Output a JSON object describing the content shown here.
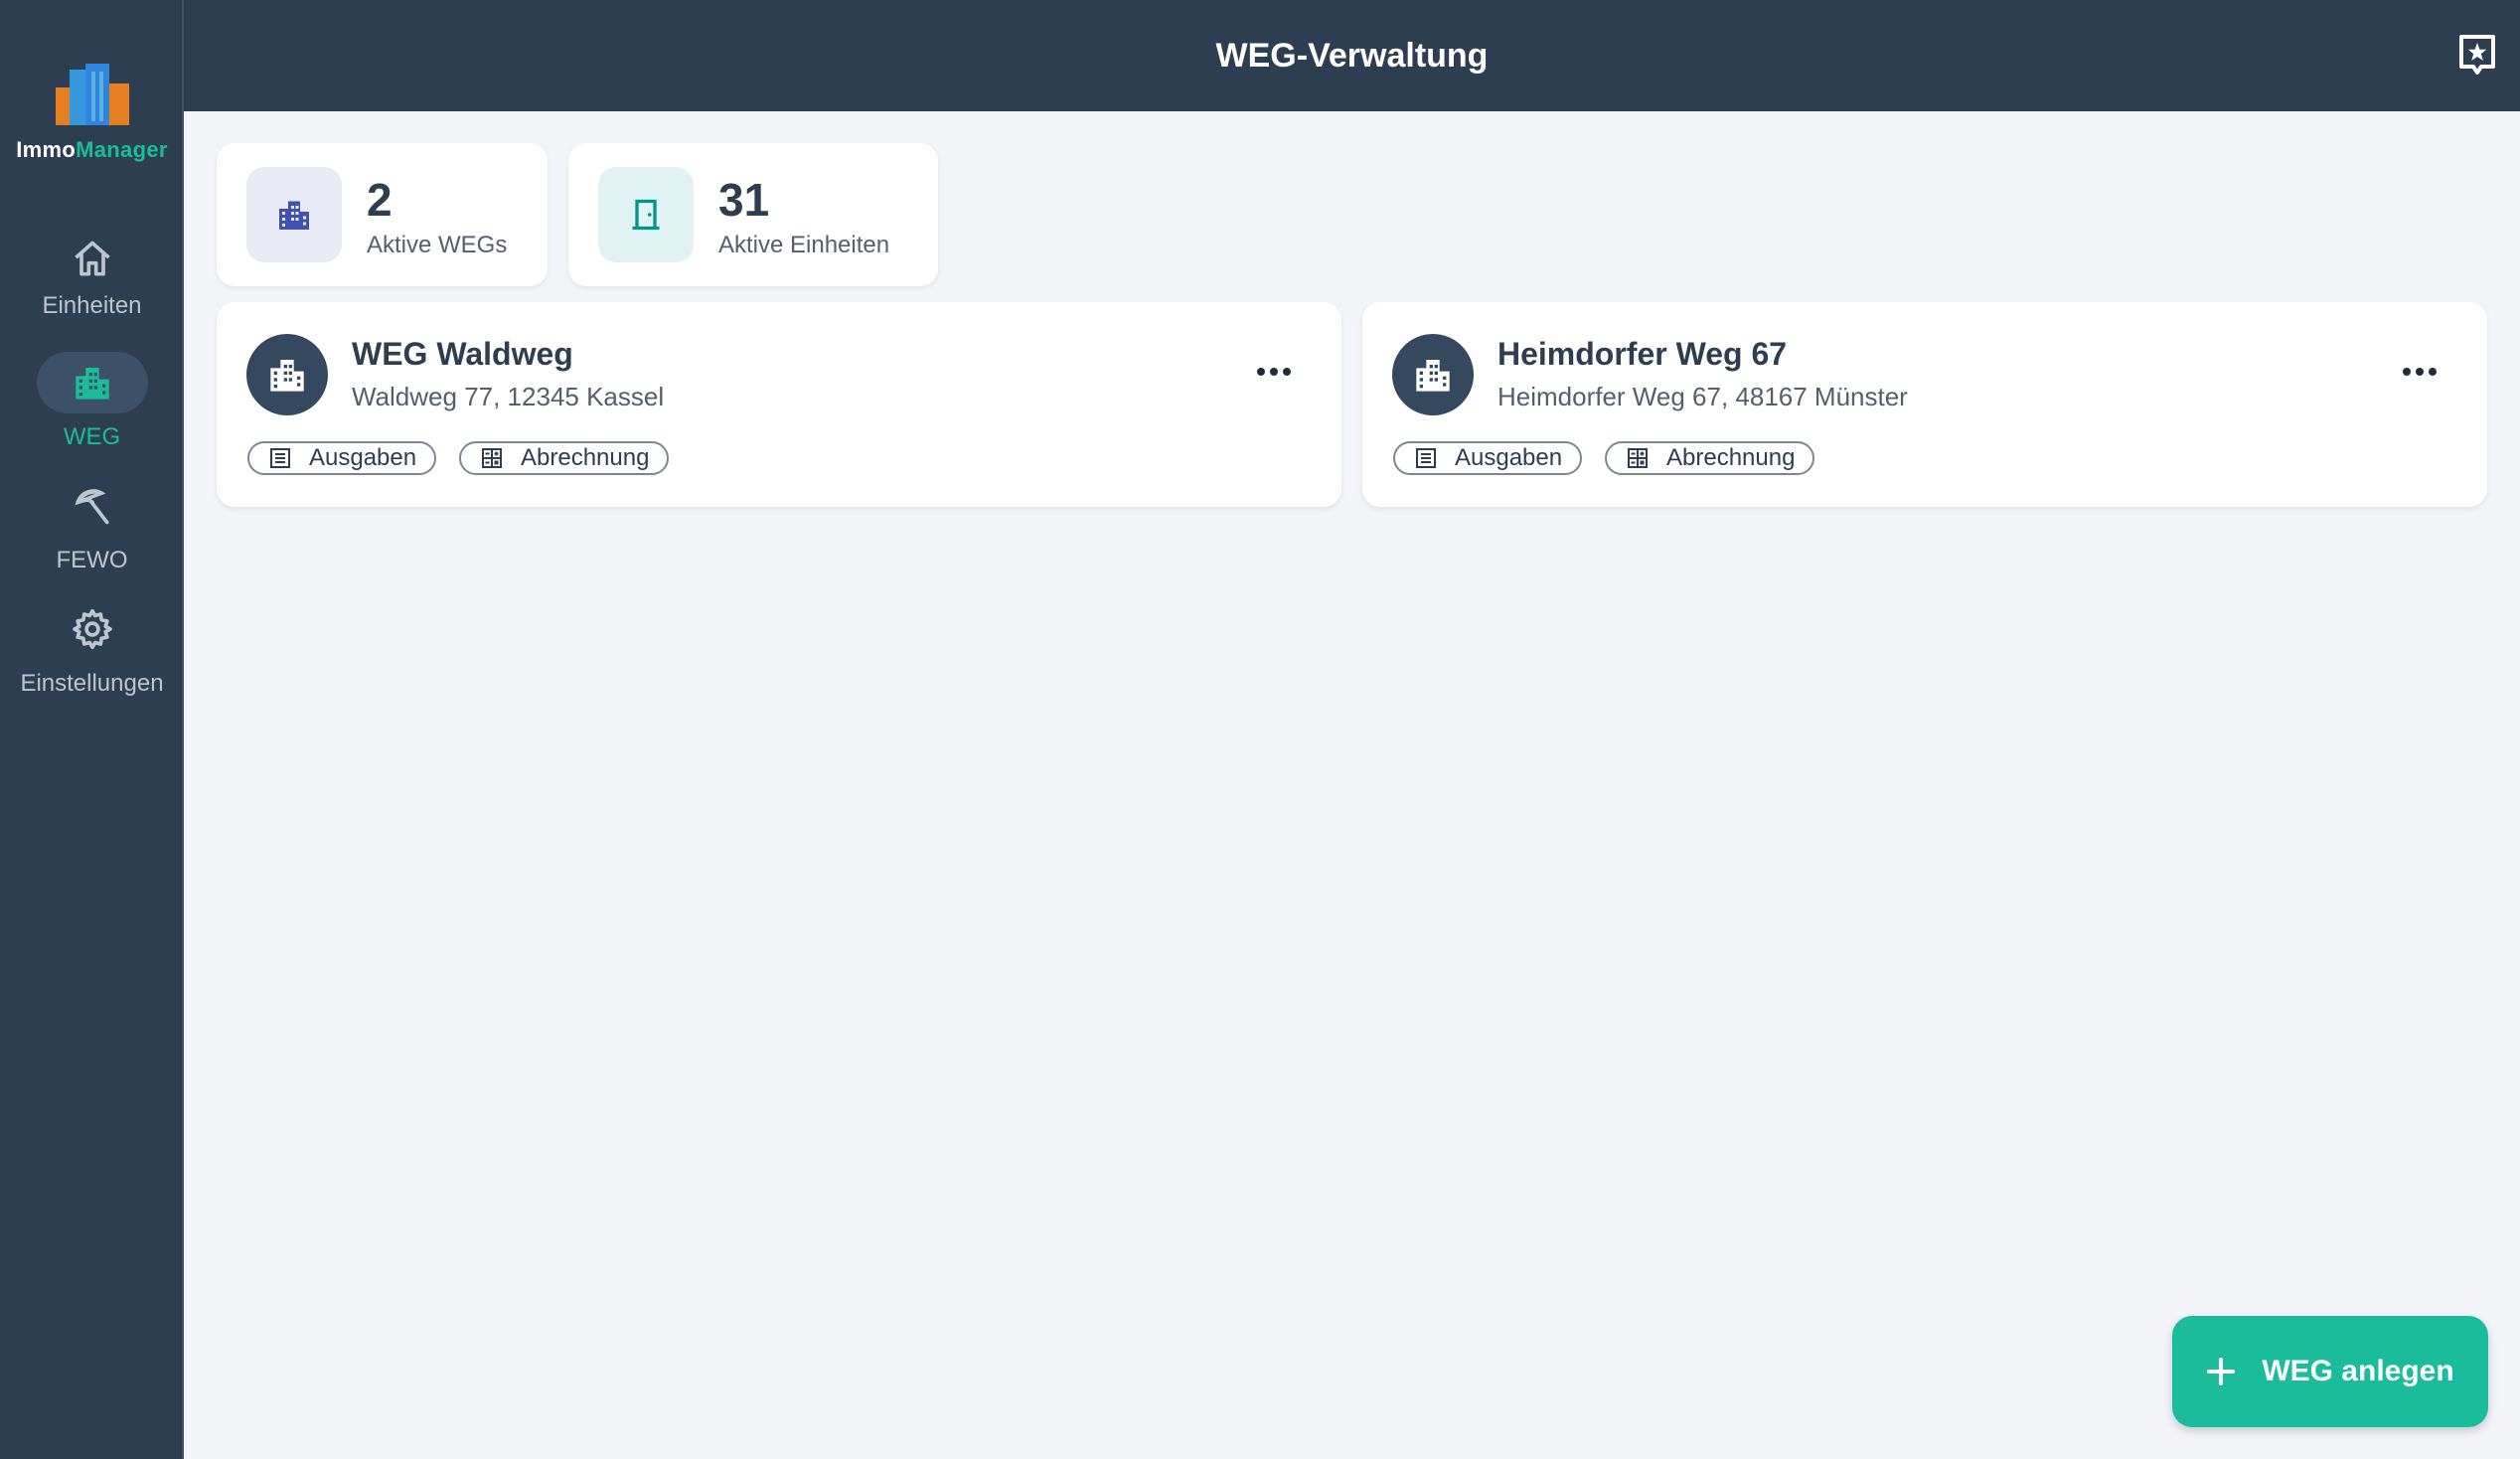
{
  "app": {
    "brand_part1": "Immo",
    "brand_part2": "Manager"
  },
  "sidebar": {
    "items": [
      {
        "label": "Einheiten",
        "icon": "home-icon",
        "active": false
      },
      {
        "label": "WEG",
        "icon": "buildings-icon",
        "active": true
      },
      {
        "label": "FEWO",
        "icon": "beach-umbrella-icon",
        "active": false
      },
      {
        "label": "Einstellungen",
        "icon": "gear-icon",
        "active": false
      }
    ]
  },
  "header": {
    "title": "WEG-Verwaltung",
    "action_icon": "add-to-home-icon"
  },
  "stats": [
    {
      "value": "2",
      "label": "Aktive WEGs",
      "icon": "apartment-icon",
      "color": "#3f51b5"
    },
    {
      "value": "31",
      "label": "Aktive Einheiten",
      "icon": "door-icon",
      "color": "#009688"
    }
  ],
  "wegs": [
    {
      "name": "WEG Waldweg",
      "address": "Waldweg 77, 12345 Kassel",
      "chips": [
        "Ausgaben",
        "Abrechnung"
      ]
    },
    {
      "name": "Heimdorfer Weg 67",
      "address": "Heimdorfer Weg 67, 48167 Münster",
      "chips": [
        "Ausgaben",
        "Abrechnung"
      ]
    }
  ],
  "fab": {
    "label": "WEG anlegen"
  },
  "colors": {
    "primary": "#2c3e50",
    "accent": "#1abc9c",
    "background": "#f3f5f9"
  }
}
